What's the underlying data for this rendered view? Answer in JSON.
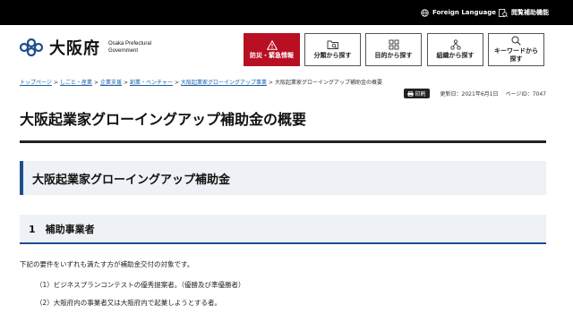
{
  "topbar": {
    "language_label": "Foreign Language",
    "accessibility_label": "閲覧補助機能"
  },
  "header": {
    "logo_text": "大阪府",
    "logo_en": "Osaka Prefectural Government",
    "logo_en_line1": "Osaka Prefectural",
    "logo_en_line2": "Government",
    "buttons": [
      {
        "line1": "防災・緊急情報",
        "line2": "",
        "icon": "warning-icon"
      },
      {
        "line1": "分類から探す",
        "line2": "",
        "icon": "folder-search-icon"
      },
      {
        "line1": "目的から探す",
        "line2": "",
        "icon": "grid-icon"
      },
      {
        "line1": "組織から探す",
        "line2": "",
        "icon": "org-chart-icon"
      },
      {
        "line1": "キーワードから",
        "line2": "探す",
        "icon": "search-icon"
      }
    ]
  },
  "breadcrumb": {
    "items": [
      "トップページ",
      "しごと・産業",
      "企業支援",
      "創業・ベンチャー",
      "大阪起業家グローイングアップ事業"
    ],
    "current": "大阪起業家グローイングアップ補助金の概要",
    "separator": ">"
  },
  "meta": {
    "print_label": "印刷",
    "updated": "更新日：2021年6月1日",
    "page_id": "ページID：7047"
  },
  "page_title": "大阪起業家グローイングアップ補助金の概要",
  "section_heading": "大阪起業家グローイングアップ補助金",
  "subsection_heading": "1　補助事業者",
  "body": {
    "paragraph": "下記の要件をいずれも満たす方が補助金交付の対象です。",
    "items": [
      "（1）ビジネスプランコンテストの優秀提案者。（優勝及び準優勝者）",
      "（2）大阪府内の事業者又は大阪府内で起業しようとする者。"
    ]
  },
  "colors": {
    "topbar": "#000000",
    "emergency": "#b80f23",
    "accent": "#1d4f8e",
    "link": "#1a5fa8",
    "heading_bg": "#eef1f5"
  }
}
